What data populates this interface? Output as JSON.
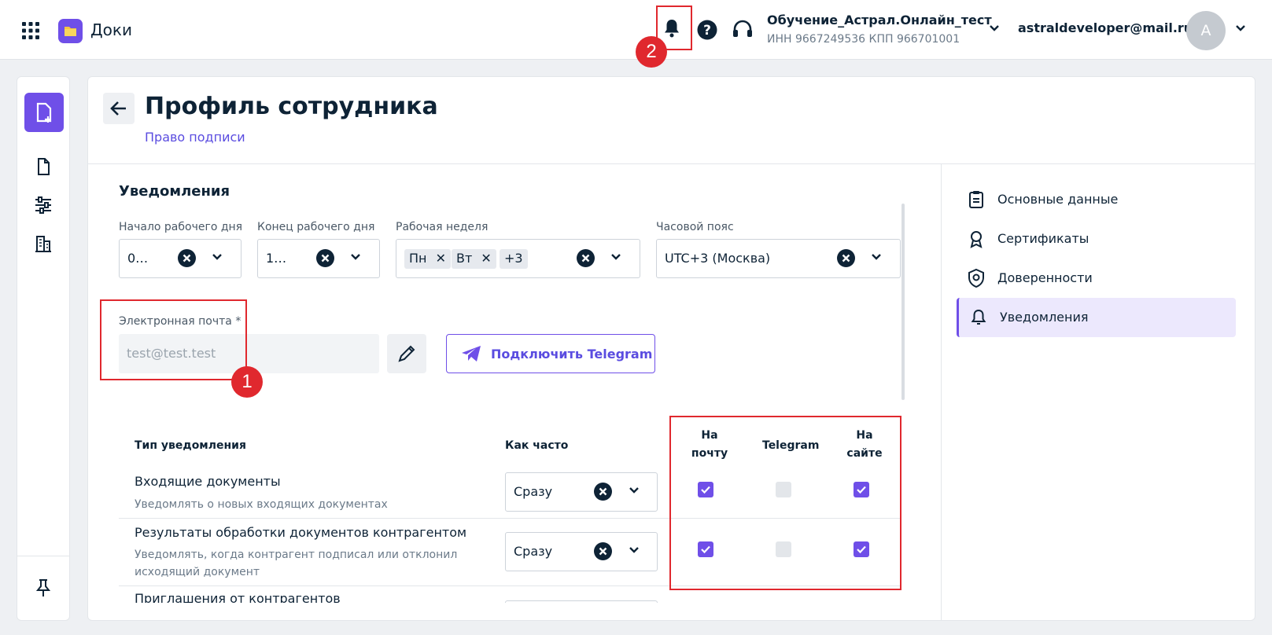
{
  "header": {
    "app_name": "Доки",
    "org_name": "Обучение_Астрал.Онлайн_тест",
    "org_ids": "ИНН 9667249536   КПП 966701001",
    "user_email": "astraldeveloper@mail.ru",
    "avatar_letter": "A"
  },
  "page": {
    "title": "Профиль сотрудника",
    "subtitle": "Право подписи"
  },
  "notifications": {
    "section_title": "Уведомления",
    "work_start": {
      "label": "Начало рабочего дня",
      "value": "0…"
    },
    "work_end": {
      "label": "Конец рабочего дня",
      "value": "1…"
    },
    "work_week": {
      "label": "Рабочая неделя",
      "chips": [
        "Пн",
        "Вт"
      ],
      "more": "+3"
    },
    "timezone": {
      "label": "Часовой пояс",
      "value": "UTC+3 (Москва)"
    },
    "email": {
      "label": "Электронная почта *",
      "placeholder": "test@test.test"
    },
    "telegram_button": "Подключить Telegram"
  },
  "table": {
    "col_type": "Тип уведомления",
    "col_freq": "Как часто",
    "col_mail_1": "На",
    "col_mail_2": "почту",
    "col_telegram": "Telegram",
    "col_site_1": "На",
    "col_site_2": "сайте",
    "rows": [
      {
        "title": "Входящие документы",
        "desc": "Уведомлять о новых входящих документах",
        "freq": "Сразу",
        "mail": true,
        "telegram": false,
        "site": true
      },
      {
        "title": "Результаты обработки документов контрагентом",
        "desc_1": "Уведомлять, когда контрагент подписал или отклонил",
        "desc_2": "исходящий документ",
        "freq": "Сразу",
        "mail": true,
        "telegram": false,
        "site": true
      },
      {
        "title": "Приглашения от контрагентов"
      }
    ]
  },
  "side_nav": {
    "items": [
      {
        "label": "Основные данные",
        "icon": "clipboard-icon"
      },
      {
        "label": "Сертификаты",
        "icon": "award-icon"
      },
      {
        "label": "Доверенности",
        "icon": "shield-icon"
      },
      {
        "label": "Уведомления",
        "icon": "bell-icon"
      }
    ],
    "active_index": 3
  },
  "annotations": {
    "badge_1": "1",
    "badge_2": "2"
  },
  "colors": {
    "accent": "#6f4fe8",
    "annotation": "#e0282e",
    "text": "#0e2336"
  }
}
